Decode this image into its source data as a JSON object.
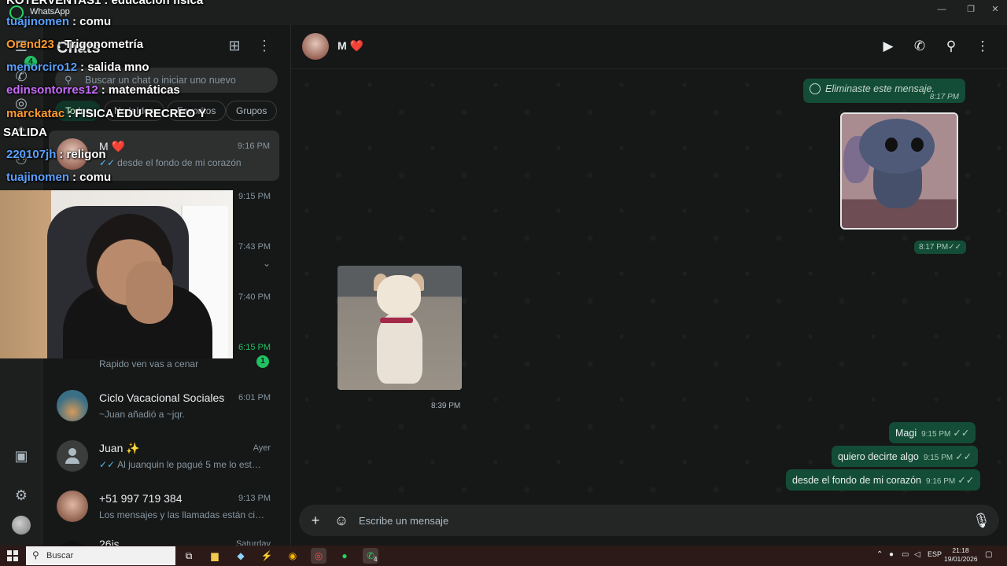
{
  "window": {
    "app_title": "WhatsApp",
    "minimize_icon": "—",
    "maximize_icon": "❐",
    "close_icon": "✕"
  },
  "rail": {
    "chats_badge": "4"
  },
  "chat_list": {
    "title": "Chats",
    "search_placeholder": "Buscar un chat o iniciar uno nuevo",
    "filters": [
      "Todos",
      "No leídos",
      "Favoritos",
      "Grupos"
    ],
    "rows": [
      {
        "name": "M ❤️",
        "time": "9:16 PM",
        "preview": "desde el fondo de mi corazón",
        "ticks": "✓✓"
      },
      {
        "name": "",
        "time": "9:15 PM",
        "preview": ""
      },
      {
        "name": "",
        "time": "7:43 PM",
        "preview": ""
      },
      {
        "name": "",
        "time": "7:40 PM",
        "preview": ""
      },
      {
        "name": "",
        "time": "6:15 PM",
        "preview": "Rapido ven vas a cenar",
        "unread": "1"
      },
      {
        "name": "Ciclo Vacacional Sociales",
        "time": "6:01 PM",
        "preview": "~Juan añadió a ~jqr."
      },
      {
        "name": "Juan ✨",
        "time": "Ayer",
        "preview": "Al juanquin le pagué 5 me lo está h...",
        "ticks": "✓✓"
      },
      {
        "name": "+51 997 719 384",
        "time": "9:13 PM",
        "preview": "Los mensajes y las llamadas están cifr..."
      },
      {
        "name": "26js",
        "time": "Saturday",
        "preview": ""
      }
    ]
  },
  "stream_chat": [
    {
      "user": "KOTERVENTAS1",
      "color": "#ffffff",
      "text": ": educación física"
    },
    {
      "user": "tuajinomen",
      "color": "#5aa0ff",
      "text": ": comu"
    },
    {
      "user": "Orend23",
      "color": "#ff9a2e",
      "text": ": Trigonometría"
    },
    {
      "user": "menorciro12",
      "color": "#5aa0ff",
      "text": ": salida mno"
    },
    {
      "user": "edinsontorres12",
      "color": "#c86bff",
      "text": ": matemáticas"
    },
    {
      "user": "marckatac",
      "color": "#ff9a2e",
      "text": ": FISICA EDU RECREO Y"
    },
    {
      "user": "",
      "color": "#ffffff",
      "text": "SALIDA"
    },
    {
      "user": "220107jh",
      "color": "#5aa0ff",
      "text": ": religon"
    },
    {
      "user": "tuajinomen",
      "color": "#5aa0ff",
      "text": ": comu"
    }
  ],
  "chat": {
    "contact_name": "M ❤️",
    "messages": {
      "deleted_text": "Eliminaste este mensaje.",
      "deleted_time": "8:17 PM",
      "image_out_time": "8:17 PM",
      "image_in_time": "8:39 PM",
      "text_out": [
        {
          "text": "Magi",
          "time": "9:15 PM"
        },
        {
          "text": "quiero decirte algo",
          "time": "9:15 PM"
        },
        {
          "text": "desde el fondo de mi corazón",
          "time": "9:16 PM"
        }
      ],
      "read_ticks": "✓✓"
    },
    "composer_placeholder": "Escribe un mensaje"
  },
  "taskbar": {
    "search_label": "Buscar",
    "whatsapp_badge": "4",
    "language": "ESP",
    "time": "21:18",
    "date": "19/01/2026"
  },
  "colors": {
    "accent": "#21c063",
    "bubble_out": "#144d37",
    "background": "#161717"
  }
}
